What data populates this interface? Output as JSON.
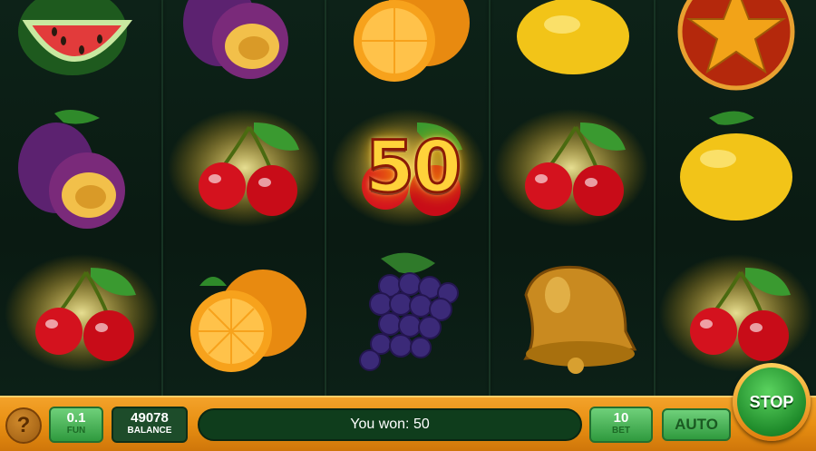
{
  "reels": {
    "columns": [
      [
        "watermelon",
        "plum",
        "cherry"
      ],
      [
        "plum",
        "cherry",
        "orange"
      ],
      [
        "orange",
        "cherry",
        "grapes"
      ],
      [
        "lemon",
        "cherry",
        "bell"
      ],
      [
        "star",
        "lemon",
        "cherry"
      ]
    ],
    "winning_symbol": "cherry",
    "win_amount": "50"
  },
  "bar": {
    "help_label": "?",
    "coin_value": "0.1",
    "coin_label": "FUN",
    "balance_value": "49078",
    "balance_label": "BALANCE",
    "message": "You won: 50",
    "bet_value": "10",
    "bet_label": "BET",
    "auto_label": "AUTO",
    "stop_label": "STOP"
  },
  "colors": {
    "bar_orange": "#e88f12",
    "button_green": "#2f9a3e",
    "message_bg": "#0f3d1c",
    "win_text": "#ffd23a"
  }
}
